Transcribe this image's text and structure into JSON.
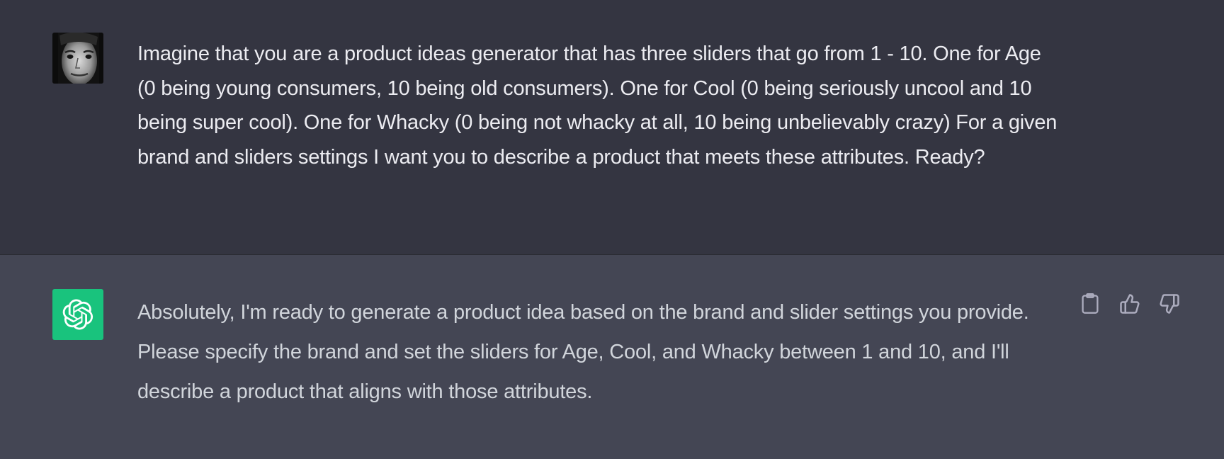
{
  "conversation": {
    "user_message": {
      "text": "Imagine that you are a product ideas generator that has three sliders that go from 1 - 10. One for Age (0 being young consumers, 10 being old consumers). One for Cool (0 being seriously uncool and 10 being super cool). One for Whacky (0 being not whacky at all, 10 being unbelievably crazy) For a given brand and sliders settings I want you to describe a product that meets these attributes. Ready?",
      "avatar_icon": "user-photo-avatar"
    },
    "assistant_message": {
      "text": "Absolutely, I'm ready to generate a product idea based on the brand and slider settings you provide. Please specify the brand and set the sliders for Age, Cool, and Whacky between 1 and 10, and I'll describe a product that aligns with those attributes.",
      "avatar_icon": "openai-logo-icon",
      "actions": [
        {
          "icon": "clipboard-icon"
        },
        {
          "icon": "thumbs-up-icon"
        },
        {
          "icon": "thumbs-down-icon"
        }
      ]
    }
  },
  "colors": {
    "user_bg": "#343541",
    "assistant_bg": "#444654",
    "gpt_avatar": "#19c37d",
    "user_text": "#ececf1",
    "assistant_text": "#d1d5db",
    "icon_color": "#acacbe"
  }
}
